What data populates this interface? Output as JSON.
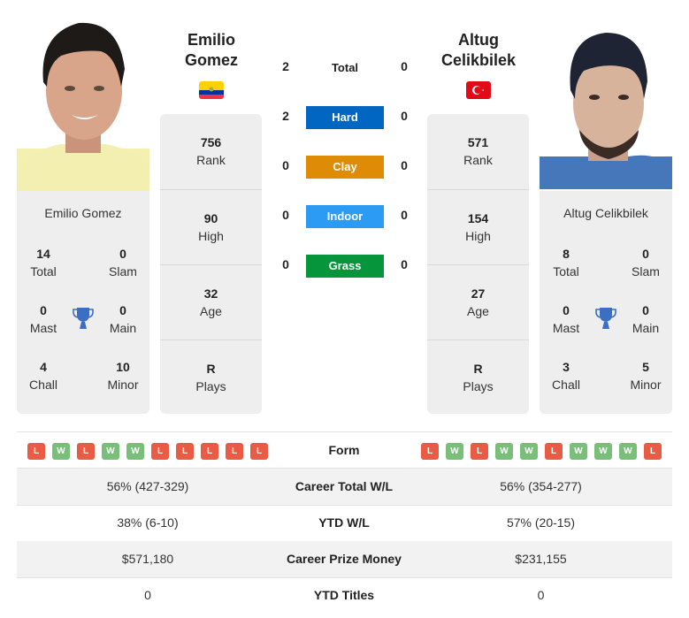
{
  "player_left": {
    "name_line1": "Emilio",
    "name_line2": "Gomez",
    "full_name": "Emilio Gomez",
    "country": "Ecuador",
    "flag_colors": [
      "#FFD100",
      "#0033A0",
      "#EF3340"
    ],
    "titles": {
      "total": {
        "value": "14",
        "label": "Total"
      },
      "slam": {
        "value": "0",
        "label": "Slam"
      },
      "mast": {
        "value": "0",
        "label": "Mast"
      },
      "main": {
        "value": "0",
        "label": "Main"
      },
      "chall": {
        "value": "4",
        "label": "Chall"
      },
      "minor": {
        "value": "10",
        "label": "Minor"
      }
    },
    "rank": {
      "value": "756",
      "label": "Rank"
    },
    "high": {
      "value": "90",
      "label": "High"
    },
    "age": {
      "value": "32",
      "label": "Age"
    },
    "plays": {
      "value": "R",
      "label": "Plays"
    },
    "form": [
      "L",
      "W",
      "L",
      "W",
      "W",
      "L",
      "L",
      "L",
      "L",
      "L"
    ]
  },
  "player_right": {
    "name_line1": "Altug",
    "name_line2": "Celikbilek",
    "full_name": "Altug Celikbilek",
    "country": "Turkey",
    "flag_colors": [
      "#E30A17",
      "#FFFFFF"
    ],
    "titles": {
      "total": {
        "value": "8",
        "label": "Total"
      },
      "slam": {
        "value": "0",
        "label": "Slam"
      },
      "mast": {
        "value": "0",
        "label": "Mast"
      },
      "main": {
        "value": "0",
        "label": "Main"
      },
      "chall": {
        "value": "3",
        "label": "Chall"
      },
      "minor": {
        "value": "5",
        "label": "Minor"
      }
    },
    "rank": {
      "value": "571",
      "label": "Rank"
    },
    "high": {
      "value": "154",
      "label": "High"
    },
    "age": {
      "value": "27",
      "label": "Age"
    },
    "plays": {
      "value": "R",
      "label": "Plays"
    },
    "form": [
      "L",
      "W",
      "L",
      "W",
      "W",
      "L",
      "W",
      "W",
      "W",
      "L"
    ]
  },
  "h2h": [
    {
      "label": "Total",
      "left": "2",
      "right": "0",
      "color": null
    },
    {
      "label": "Hard",
      "left": "2",
      "right": "0",
      "color": "#0066C2"
    },
    {
      "label": "Clay",
      "left": "0",
      "right": "0",
      "color": "#DE8C05"
    },
    {
      "label": "Indoor",
      "left": "0",
      "right": "0",
      "color": "#2B9BF4"
    },
    {
      "label": "Grass",
      "left": "0",
      "right": "0",
      "color": "#07953C"
    }
  ],
  "form_label": "Form",
  "stats": [
    {
      "label": "Career Total W/L",
      "left": "56% (427-329)",
      "right": "56% (354-277)"
    },
    {
      "label": "YTD W/L",
      "left": "38% (6-10)",
      "right": "57% (20-15)"
    },
    {
      "label": "Career Prize Money",
      "left": "$571,180",
      "right": "$231,155"
    },
    {
      "label": "YTD Titles",
      "left": "0",
      "right": "0"
    }
  ],
  "colors": {
    "loss": "#E95B44",
    "win": "#79BF7A",
    "trophy": "#3A6FC4"
  }
}
